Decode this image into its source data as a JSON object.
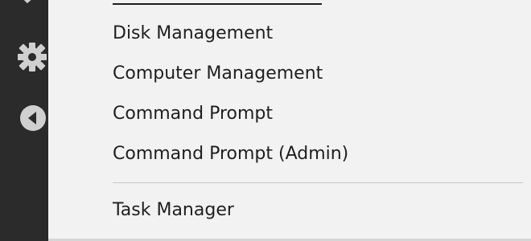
{
  "sidebar": {
    "icons": [
      "partial-icon",
      "gear-icon",
      "back-arrow-icon"
    ]
  },
  "menu": {
    "items": [
      {
        "label": "Disk Management"
      },
      {
        "label": "Computer Management"
      },
      {
        "label": "Command Prompt"
      },
      {
        "label": "Command Prompt (Admin)"
      },
      {
        "label": "Task Manager"
      }
    ]
  },
  "colors": {
    "sidebar_bg": "#2b2b2b",
    "menu_bg": "#f2f2f2",
    "text": "#1f1f1f",
    "icon": "#d0d0d0",
    "separator": "#c8c8c8"
  }
}
